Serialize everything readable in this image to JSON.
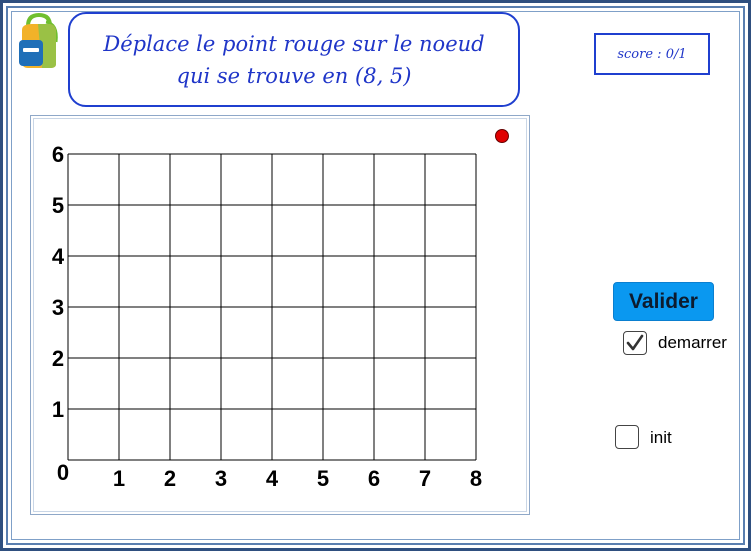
{
  "instruction": {
    "line1": "Déplace le point rouge sur le noeud",
    "line2": "qui se trouve en (8, 5)"
  },
  "score": {
    "text": "score : 0/1"
  },
  "grid": {
    "x_ticks": [
      "0",
      "1",
      "2",
      "3",
      "4",
      "5",
      "6",
      "7",
      "8"
    ],
    "y_ticks": [
      "1",
      "2",
      "3",
      "4",
      "5",
      "6"
    ],
    "x_range": [
      0,
      8
    ],
    "y_range": [
      0,
      6
    ],
    "point_color": "#e00000"
  },
  "buttons": {
    "valider": "Valider"
  },
  "checkboxes": {
    "demarrer": {
      "label": "demarrer",
      "checked": true
    },
    "init": {
      "label": "init",
      "checked": false
    }
  },
  "colors": {
    "accent": "#1f35c8",
    "button": "#0a98f0"
  }
}
